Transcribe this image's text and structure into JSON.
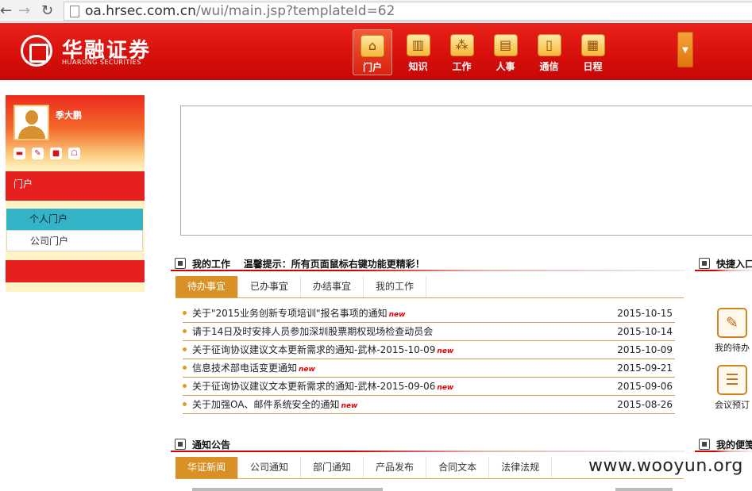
{
  "browser": {
    "url_host": "oa.hrsec.com.cn",
    "url_path": "/wui/main.jsp?templateId=62"
  },
  "header": {
    "logo_cn": "华融证券",
    "logo_en": "HUARONG SECURITIES",
    "nav": [
      {
        "label": "门户",
        "icon": "home-icon",
        "glyph": "⌂",
        "active": true
      },
      {
        "label": "知识",
        "icon": "book-icon",
        "glyph": "▥",
        "active": false
      },
      {
        "label": "工作",
        "icon": "work-icon",
        "glyph": "⁂",
        "active": false
      },
      {
        "label": "人事",
        "icon": "document-icon",
        "glyph": "▤",
        "active": false
      },
      {
        "label": "通信",
        "icon": "phone-icon",
        "glyph": "▯",
        "active": false
      },
      {
        "label": "日程",
        "icon": "calendar-icon",
        "glyph": "▦",
        "active": false
      }
    ]
  },
  "sidebar": {
    "username": "季大鹏",
    "portal_label": "门户",
    "submenu": [
      {
        "label": "个人门户",
        "active": true
      },
      {
        "label": "公司门户",
        "active": false
      }
    ]
  },
  "work": {
    "title": "我的工作",
    "tip": "温馨提示：所有页面鼠标右键功能更精彩！",
    "tabs": [
      "待办事宜",
      "已办事宜",
      "办结事宜",
      "我的工作"
    ],
    "new_badge": "new",
    "items": [
      {
        "title": "关于\"2015业务创新专项培训\"报名事项的通知",
        "date": "2015-10-15",
        "new": true
      },
      {
        "title": "请于14日及时安排人员参加深圳股票期权现场检查动员会",
        "date": "2015-10-14",
        "new": false
      },
      {
        "title": "关于征询协议建议文本更新需求的通知-武林-2015-10-09",
        "date": "2015-10-09",
        "new": true
      },
      {
        "title": "信息技术部电话变更通知",
        "date": "2015-09-21",
        "new": true
      },
      {
        "title": "关于征询协议建议文本更新需求的通知-武林-2015-09-06",
        "date": "2015-09-06",
        "new": true
      },
      {
        "title": "关于加强OA、邮件系统安全的通知",
        "date": "2015-08-26",
        "new": true
      }
    ]
  },
  "quick": {
    "title": "快捷入口",
    "items": [
      {
        "label": "我的待办",
        "icon": "pencil-icon",
        "glyph": "✎"
      },
      {
        "label": "会议预订",
        "icon": "notebook-icon",
        "glyph": "☰"
      }
    ]
  },
  "notice": {
    "title": "通知公告",
    "tabs": [
      "华证新闻",
      "公司通知",
      "部门通知",
      "产品发布",
      "合同文本",
      "法律法规"
    ]
  },
  "memo": {
    "title": "我的便笺"
  },
  "watermark": "www.wooyun.org"
}
